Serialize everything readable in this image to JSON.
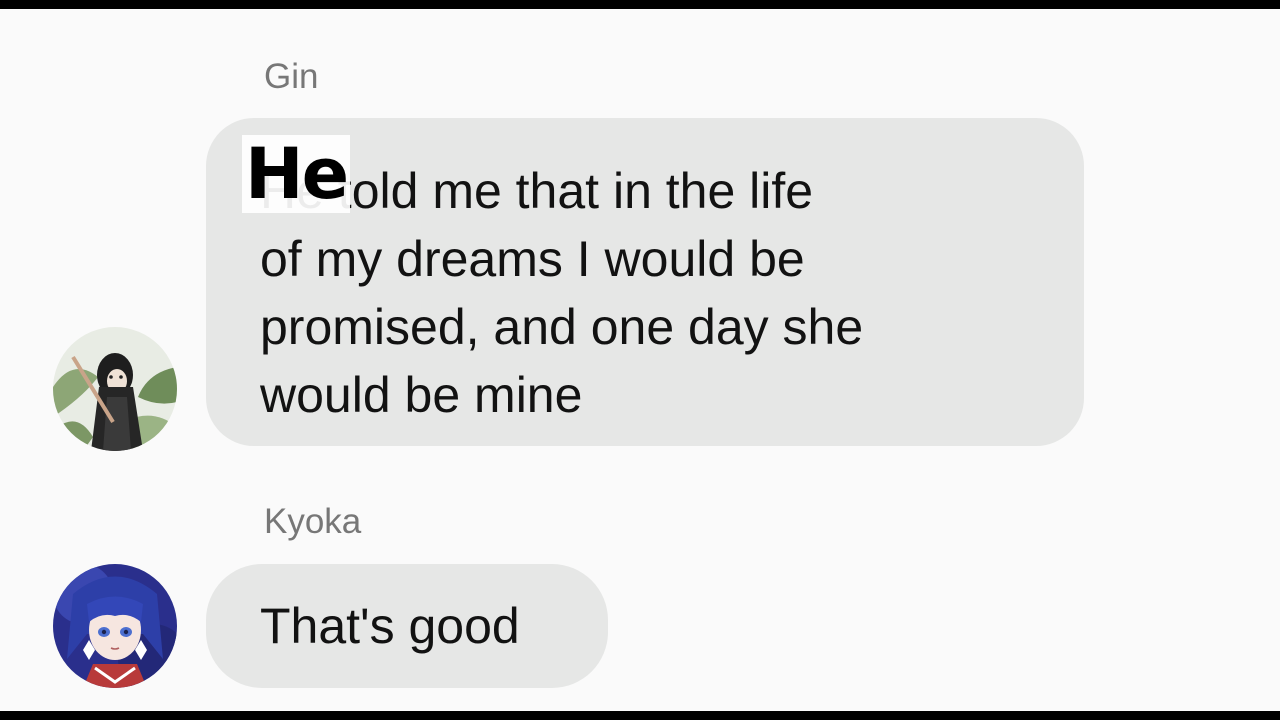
{
  "messages": [
    {
      "sender": "Gin",
      "avatar_icon": "gin-avatar-icon",
      "overlay_word": "He",
      "lines": [
        "He told me that in the life",
        "of my dreams I would be",
        "promised, and one day she",
        "would be mine"
      ]
    },
    {
      "sender": "Kyoka",
      "avatar_icon": "kyoka-avatar-icon",
      "lines": [
        "That's good"
      ]
    }
  ],
  "colors": {
    "background": "#fafafa",
    "bubble": "#e6e7e6",
    "sender_name": "#777777",
    "message_text": "#121212",
    "letterbox": "#000000"
  }
}
